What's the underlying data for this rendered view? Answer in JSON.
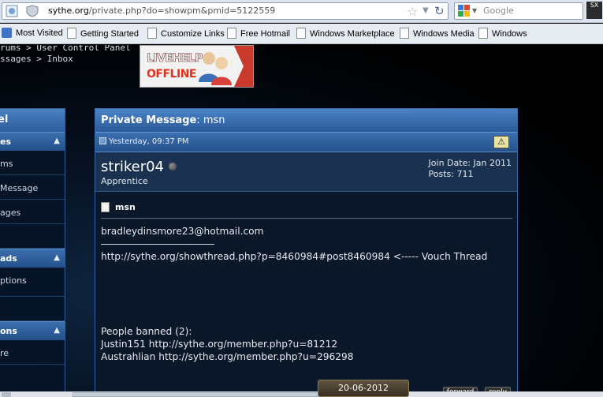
{
  "browser": {
    "url_domain": "sythe.org",
    "url_path": "/private.php?do=showpm&pmid=5122559",
    "search_placeholder": "Google",
    "addon_label": "SX"
  },
  "bookmarks": [
    {
      "label": "Most Visited",
      "icon": "most-visited-icon"
    },
    {
      "label": "Getting Started",
      "icon": "page-icon"
    },
    {
      "label": "Customize Links",
      "icon": "page-icon"
    },
    {
      "label": "Free Hotmail",
      "icon": "page-icon"
    },
    {
      "label": "Windows Marketplace",
      "icon": "page-icon"
    },
    {
      "label": "Windows Media",
      "icon": "page-icon"
    },
    {
      "label": "Windows",
      "icon": "page-icon"
    }
  ],
  "breadcrumb": {
    "line1": "rums > User Control Panel",
    "line2": "ssages > Inbox"
  },
  "live_help": {
    "line1": "LIVEHELP",
    "line2": "OFFLINE"
  },
  "left_panel": {
    "title": "el",
    "sections": [
      {
        "label": "es",
        "items": [
          "ms",
          "Message",
          "ages",
          ""
        ]
      },
      {
        "label": "ads",
        "items": [
          "ptions",
          ""
        ]
      },
      {
        "label": "ons",
        "items": [
          "re"
        ]
      }
    ]
  },
  "message": {
    "header_label": "Private Message",
    "header_subject": ": msn",
    "date": "Yesterday, 09:37 PM",
    "username": "striker04",
    "rank": "Apprentice",
    "join_date": "Join Date: Jan 2011",
    "posts": "Posts: 711",
    "subject": "msn",
    "line_email": "bradleydinsmore23@hotmail.com",
    "line_link": "http://sythe.org/showthread.php?p=8460984#post8460984 <----- Vouch Thread",
    "line_banned": "People banned (2):",
    "line_ban1": "Justin151 http://sythe.org/member.php?u=81212",
    "line_ban2": "Austrahlian http://sythe.org/member.php?u=296298",
    "forward_label": "forward",
    "reply_label": "reply"
  },
  "date_stamp": "20-06-2012",
  "colors": {
    "panel_header": "#3a6fad",
    "offline_red": "#e2321e",
    "page_bg": "#000000"
  }
}
